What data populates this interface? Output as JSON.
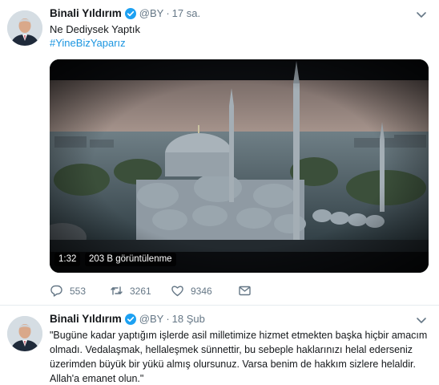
{
  "tweets": [
    {
      "author_name": "Binali Yıldırım",
      "handle": "@BY",
      "separator": "·",
      "time": "17 sa.",
      "text": "Ne Dediysek Yaptık",
      "hashtag": "#YineBizYaparız",
      "video": {
        "duration": "1:32",
        "views": "203 B görüntülenme"
      },
      "actions": {
        "replies": "553",
        "retweets": "3261",
        "likes": "9346"
      }
    },
    {
      "author_name": "Binali Yıldırım",
      "handle": "@BY",
      "separator": "·",
      "time": "18 Şub",
      "text": "\"Bugüne kadar yaptığım işlerde asil milletimize hizmet etmekten başka hiçbir amacım olmadı. Vedalaşmak, hellaleşmek sünnettir, bu sebeple haklarınızı helal ederseniz üzerimden büyük bir yükü almış olursunuz. Varsa benim de hakkım sizlere helaldir. Allah'a emanet olun.\""
    }
  ],
  "colors": {
    "link": "#1b95e0",
    "secondary_text": "#657786",
    "verified": "#1da1f2"
  },
  "icons": [
    "chevron-down-icon",
    "verified-badge-icon",
    "reply-icon",
    "retweet-icon",
    "like-icon",
    "direct-message-icon"
  ]
}
